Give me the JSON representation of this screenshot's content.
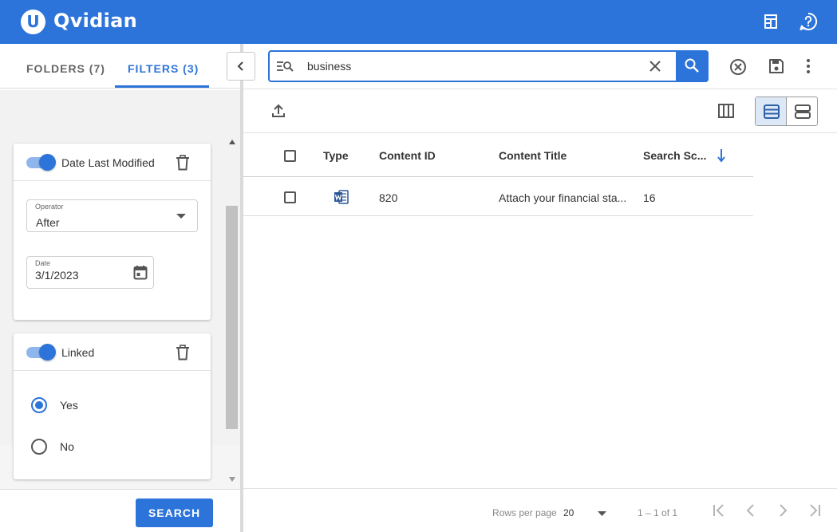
{
  "app": {
    "logo_letter": "U",
    "brand": "Qvidian"
  },
  "colors": {
    "primary": "#2d74da",
    "primary_light": "#8fb6ec",
    "selected_bg": "#dde8f7"
  },
  "header": {
    "icons": [
      "calculator-icon",
      "help-icon"
    ]
  },
  "left_panel": {
    "tabs": [
      {
        "label": "FOLDERS (7)"
      },
      {
        "label": "FILTERS (3)",
        "active": true
      }
    ],
    "toolbar_icons": [
      "more-vert-icon",
      "tune-icon"
    ],
    "filters": [
      {
        "title": "Date Last Modified",
        "enabled": true,
        "operator": {
          "label": "Operator",
          "value": "After"
        },
        "date": {
          "label": "Date",
          "value": "3/1/2023"
        }
      },
      {
        "title": "Linked",
        "enabled": true,
        "options": [
          {
            "label": "Yes",
            "selected": true
          },
          {
            "label": "No",
            "selected": false
          }
        ]
      }
    ],
    "search_button": "SEARCH"
  },
  "search": {
    "query": "business"
  },
  "table": {
    "columns": [
      "Type",
      "Content ID",
      "Content Title",
      "Search Sc..."
    ],
    "sort_column": "Search Sc...",
    "sort_direction": "descending",
    "rows": [
      {
        "type": "word-document-icon",
        "content_id": "820",
        "content_title": "Attach your financial sta...",
        "search_score": "16"
      }
    ]
  },
  "footer": {
    "rows_per_page_label": "Rows per page",
    "rows_per_page": "20",
    "range": "1 – 1 of 1"
  }
}
